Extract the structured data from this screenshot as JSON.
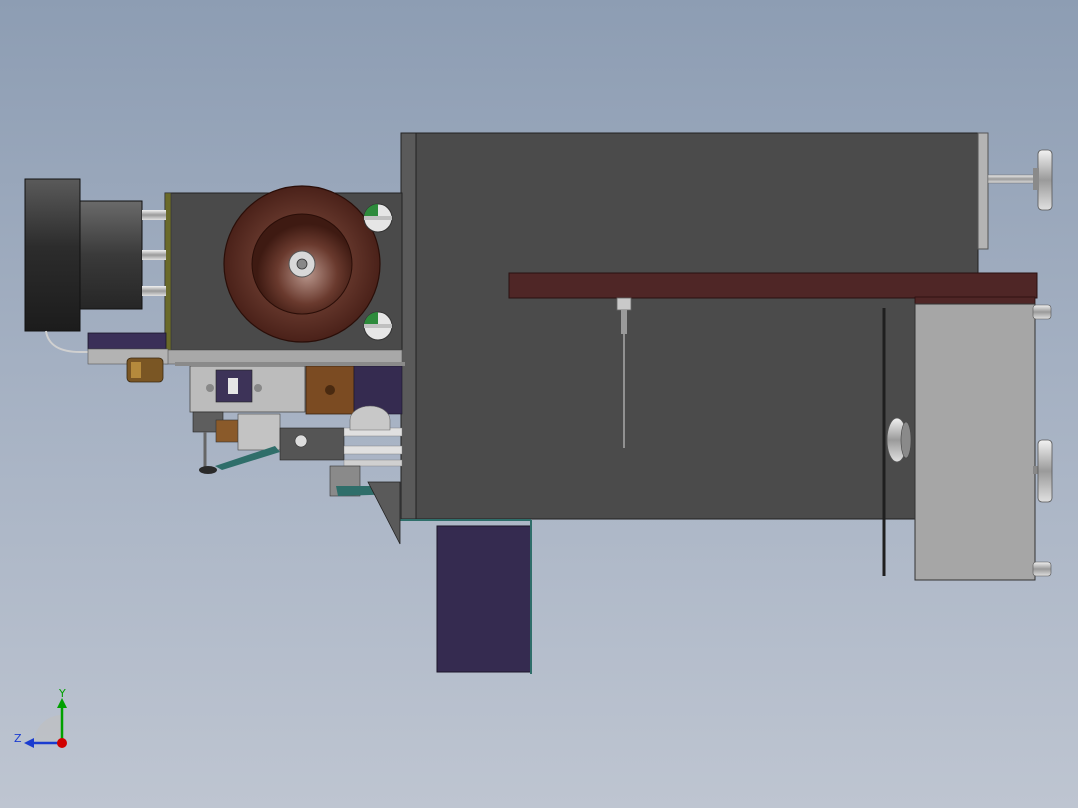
{
  "viewport": {
    "background_top": "#8d9db3",
    "background_bottom": "#bec5d1"
  },
  "colors": {
    "cabinet": "#4a4a4a",
    "cabinet_edge": "#2b2b2b",
    "maroon": "#4f2626",
    "navy_purple": "#352b50",
    "motor_gray": "#3d3d3d",
    "bronze": "#6a3b2f",
    "steel": "#c8c8c8",
    "light_panel": "#a7a7a7",
    "teal_frame": "#2f6e6a",
    "axis_x": "#d00000",
    "axis_y": "#00a000",
    "axis_z": "#1a3cd0"
  },
  "triad": {
    "y_label": "Y",
    "z_label": "Z",
    "icon": "coordinate-triad-icon"
  }
}
